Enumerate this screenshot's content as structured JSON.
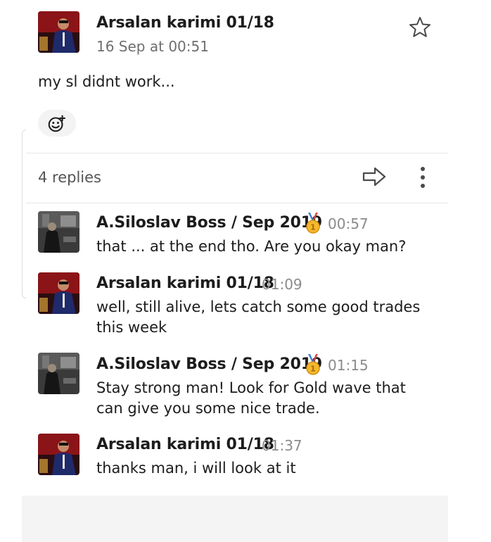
{
  "parent": {
    "author": "Arsalan karimi 01/18",
    "timestamp": "16 Sep at 00:51",
    "text": "my sl didnt work..."
  },
  "thread": {
    "replies_label": "4 replies"
  },
  "replies": [
    {
      "author": "A.Siloslav Boss / Sep 2019",
      "badge": "1st place medal",
      "time": "00:57",
      "text": "that ... at the end tho. Are you okay man?"
    },
    {
      "author": "Arsalan karimi 01/18",
      "time": "01:09",
      "text_line1": "well, still alive, lets catch some good trades",
      "text_line2": "this week"
    },
    {
      "author": "A.Siloslav Boss / Sep 2019",
      "badge": "1st place medal",
      "time": "01:15",
      "text_line1": "Stay strong man! Look for Gold wave that",
      "text_line2": "can give you some nice trade."
    },
    {
      "author": "Arsalan karimi 01/18",
      "time": "01:37",
      "text": "thanks man, i will look at it"
    }
  ],
  "icons": {
    "star": "star-icon",
    "add_reaction": "add-reaction-icon",
    "share": "share-arrow-icon",
    "more": "more-vertical-icon",
    "medal": "medal-icon"
  },
  "colors": {
    "text": "#1d1c1d",
    "muted": "#8b8b8b",
    "composer_bg": "#f4f4f4"
  }
}
